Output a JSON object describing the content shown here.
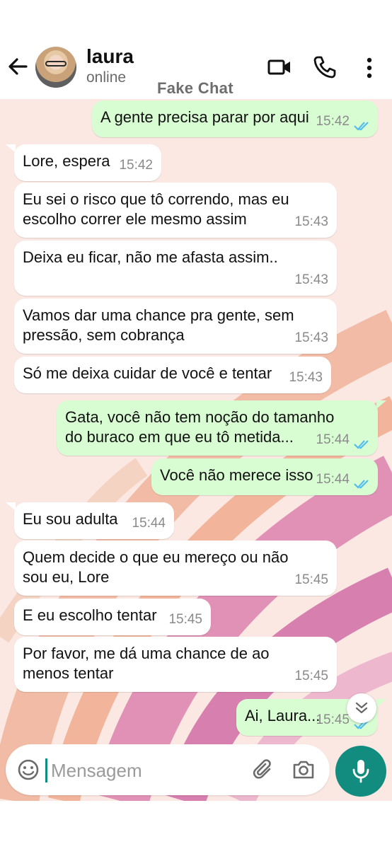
{
  "header": {
    "contact_name": "laura",
    "status": "online",
    "watermark": "Fake Chat"
  },
  "messages": [
    {
      "direction": "out",
      "lines": "A gente precisa parar por aqui",
      "time": "15:42",
      "read": true
    },
    {
      "direction": "in",
      "lines": "Lore, espera",
      "time": "15:42"
    },
    {
      "direction": "in",
      "lines": "Eu sei o risco que tô correndo, mas eu\nescolho correr ele mesmo assim",
      "time": "15:43"
    },
    {
      "direction": "in",
      "lines": "Deixa eu ficar, não me afasta assim..",
      "time": "15:43"
    },
    {
      "direction": "in",
      "lines": "Vamos dar uma chance pra gente, sem\npressão, sem cobrança",
      "time": "15:43"
    },
    {
      "direction": "in",
      "lines": "Só me deixa cuidar de você e tentar",
      "time": "15:43"
    },
    {
      "direction": "out",
      "lines": "Gata, você não tem noção do tamanho\ndo buraco em que eu tô metida...",
      "time": "15:44",
      "read": true
    },
    {
      "direction": "out",
      "lines": "Você não merece isso",
      "time": "15:44",
      "read": true
    },
    {
      "direction": "in",
      "lines": "Eu sou adulta",
      "time": "15:44"
    },
    {
      "direction": "in",
      "lines": "Quem decide o que eu mereço ou não\nsou eu, Lore",
      "time": "15:45"
    },
    {
      "direction": "in",
      "lines": "E eu escolho tentar",
      "time": "15:45"
    },
    {
      "direction": "in",
      "lines": "Por favor, me dá uma chance de ao\nmenos tentar",
      "time": "15:45"
    },
    {
      "direction": "out",
      "lines": "Ai, Laura...",
      "time": "15:45",
      "read": true
    }
  ],
  "input": {
    "placeholder": "Mensagem"
  },
  "icons": {
    "back": "arrow-left-icon",
    "video": "video-call-icon",
    "call": "phone-icon",
    "menu": "more-vertical-icon",
    "scroll": "double-chevron-down-icon",
    "emoji": "emoji-icon",
    "attach": "paperclip-icon",
    "camera": "camera-icon",
    "mic": "microphone-icon"
  },
  "colors": {
    "outgoing_bubble": "#d9fdd3",
    "incoming_bubble": "#ffffff",
    "read_ticks": "#53bdeb",
    "accent": "#128c7e",
    "chat_background": "#fbe8e2"
  }
}
